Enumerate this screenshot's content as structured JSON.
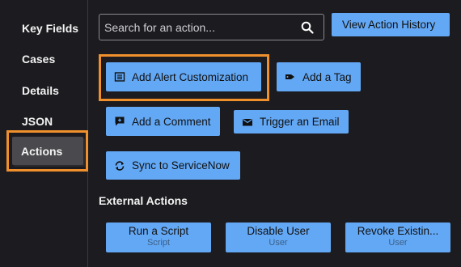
{
  "sidebar": {
    "items": [
      {
        "label": "Key Fields"
      },
      {
        "label": "Cases"
      },
      {
        "label": "Details"
      },
      {
        "label": "JSON"
      },
      {
        "label": "Actions"
      }
    ]
  },
  "search": {
    "placeholder": "Search for an action..."
  },
  "header": {
    "history_label": "View Action History"
  },
  "actions": {
    "alert_customization": "Add Alert Customization",
    "tag": "Add a Tag",
    "comment": "Add a Comment",
    "email": "Trigger an Email",
    "servicenow": "Sync to ServiceNow"
  },
  "external": {
    "title": "External Actions",
    "items": [
      {
        "label": "Run a Script",
        "sub": "Script"
      },
      {
        "label": "Disable User",
        "sub": "User"
      },
      {
        "label": "Revoke Existin...",
        "sub": "User"
      }
    ]
  },
  "colors": {
    "accent": "#63a8f5",
    "highlight": "#f0902d",
    "background": "#1c1b1f"
  }
}
